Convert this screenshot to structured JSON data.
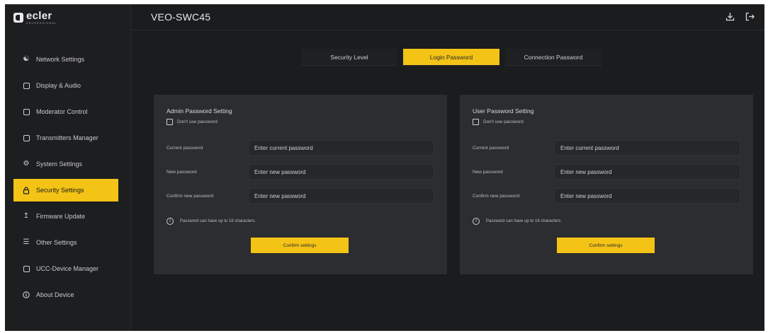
{
  "brand": {
    "name": "ecler",
    "tagline": "PROFESSIONAL"
  },
  "header": {
    "device_name": "VEO-SWC45"
  },
  "sidebar": {
    "items": [
      {
        "label": "Network Settings",
        "icon": "network-icon"
      },
      {
        "label": "Display & Audio",
        "icon": "display-icon"
      },
      {
        "label": "Moderator Control",
        "icon": "moderator-icon"
      },
      {
        "label": "Transmitters Manager",
        "icon": "transmitter-icon"
      },
      {
        "label": "System Settings",
        "icon": "gear-icon"
      },
      {
        "label": "Security Settings",
        "icon": "lock-icon",
        "active": true
      },
      {
        "label": "Firmware Update",
        "icon": "upload-icon"
      },
      {
        "label": "Other Settings",
        "icon": "sliders-icon"
      },
      {
        "label": "UCC-Device Manager",
        "icon": "device-manager-icon"
      },
      {
        "label": "About Device",
        "icon": "info-icon"
      }
    ]
  },
  "tabs": [
    {
      "label": "Security Level"
    },
    {
      "label": "Login Password",
      "active": true
    },
    {
      "label": "Connection Password"
    }
  ],
  "admin": {
    "title": "Admin Password Setting",
    "no_password_label": "Don't use password",
    "current_label": "Current password",
    "current_placeholder": "Enter current password",
    "new_label": "New password",
    "new_placeholder": "Enter new password",
    "confirm_label": "Confirm new password",
    "confirm_placeholder": "Enter new password",
    "note": "Password can have up to 16 characters.",
    "button": "Confirm settings"
  },
  "user": {
    "title": "User Password Setting",
    "no_password_label": "Don't use password",
    "current_label": "Current password",
    "current_placeholder": "Enter current password",
    "new_label": "New password",
    "new_placeholder": "Enter new password",
    "confirm_label": "Confirm new password",
    "confirm_placeholder": "Enter new password",
    "note": "Password can have up to 16 characters.",
    "button": "Confirm settings"
  },
  "colors": {
    "accent": "#f3c316",
    "background": "#1b1c1e",
    "panel": "#2c2d30"
  }
}
